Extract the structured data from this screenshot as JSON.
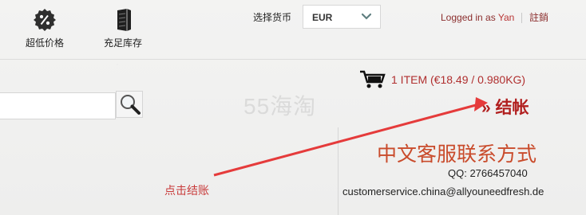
{
  "features": [
    {
      "label": "超低价格",
      "icon": "percent-badge-icon"
    },
    {
      "label": "充足库存",
      "icon": "warehouse-shelves-icon"
    }
  ],
  "currency": {
    "label": "选择货币",
    "selected": "EUR"
  },
  "account": {
    "logged_in_text": "Logged in as",
    "username": "Yan",
    "logout_label": "註銷"
  },
  "cart": {
    "summary": "1 ITEM (€18.49 / 0.980KG)"
  },
  "checkout": {
    "label": "» 结帐"
  },
  "watermark": {
    "text": "55海淘"
  },
  "contact": {
    "title": "中文客服联系方式",
    "qq": "QQ: 2766457040",
    "email": "customerservice.china@allyouneedfresh.de"
  },
  "annotation": {
    "text": "点击结账"
  },
  "colors": {
    "accent_red": "#b11f1f",
    "contact_orange_red": "#c94b2b",
    "login_dark_red": "#8b2e2e",
    "annotation_red": "#e53b3b"
  }
}
